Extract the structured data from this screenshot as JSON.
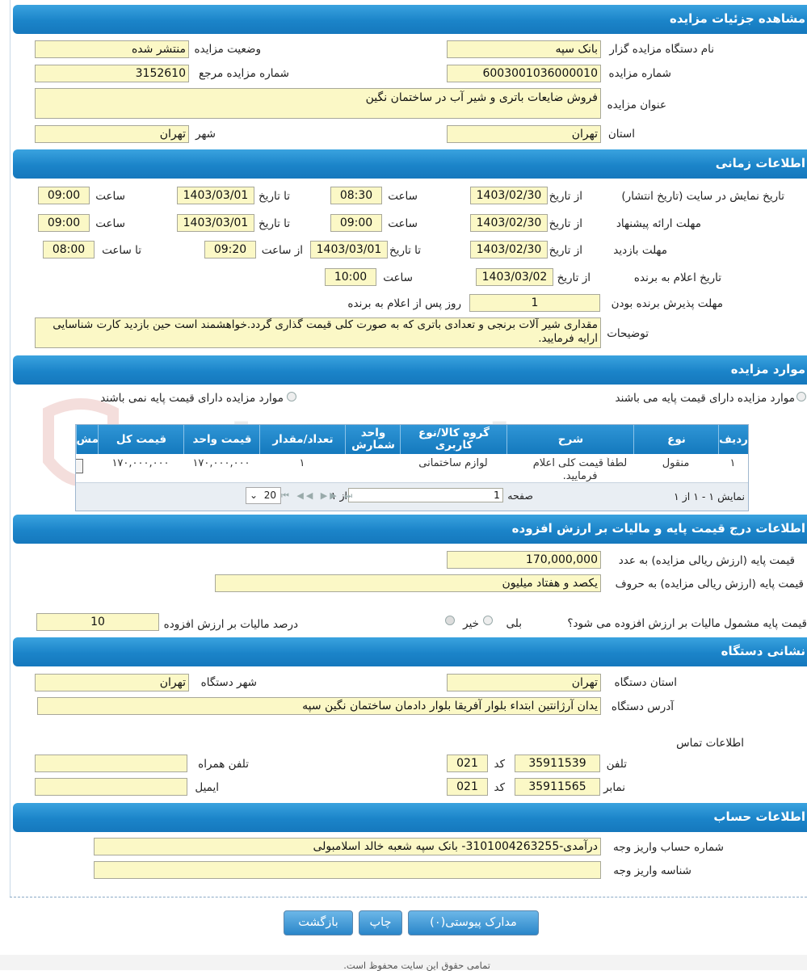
{
  "sections": {
    "details": "مشاهده جزئیات مزایده",
    "time": "اطلاعات زمانی",
    "items": "موارد مزایده",
    "price": "اطلاعات درج قیمت پایه و مالیات بر ارزش افزوده",
    "address": "نشانی دستگاه",
    "account": "اطلاعات حساب"
  },
  "details": {
    "org_label": "نام دستگاه مزایده گزار",
    "org_value": "بانک سپه",
    "status_label": "وضعیت مزایده",
    "status_value": "منتشر شده",
    "number_label": "شماره مزایده",
    "number_value": "6003001036000010",
    "ref_label": "شماره مزایده مرجع",
    "ref_value": "3152610",
    "title_label": "عنوان مزایده",
    "title_value": "فروش ضایعات باتری و شیر آب در ساختمان نگین",
    "province_label": "استان",
    "province_value": "تهران",
    "city_label": "شهر",
    "city_value": "تهران"
  },
  "time": {
    "display_label": "تاریخ نمایش در سایت (تاریخ انتشار)",
    "offer_label": "مهلت ارائه پیشنهاد",
    "visit_label": "مهلت بازدید",
    "announce_label": "تاریخ اعلام به برنده",
    "accept_label": "مهلت پذیرش برنده بودن",
    "from_date": "از تاریخ",
    "to_date": "تا تاریخ",
    "hour": "ساعت",
    "from_hour": "از ساعت",
    "to_hour": "تا ساعت",
    "display_from": "1403/02/30",
    "display_from_time": "08:30",
    "display_to": "1403/03/01",
    "display_to_time": "09:00",
    "offer_from": "1403/02/30",
    "offer_from_time": "09:00",
    "offer_to": "1403/03/01",
    "offer_to_time": "09:00",
    "visit_from": "1403/02/30",
    "visit_to": "1403/03/01",
    "visit_from_time": "09:20",
    "visit_to_time": "08:00",
    "announce_date": "1403/03/02",
    "announce_time": "10:00",
    "accept_days": "1",
    "accept_suffix": "روز پس از اعلام به برنده",
    "desc_label": "توضیحات",
    "desc_value": "مقداری شیر آلات برنجی و تعدادی باتری که به صورت کلی قیمت گذاری گردد.خواهشمند است حین بازدید کارت شناسایی ارایه فرمایید."
  },
  "items": {
    "radio_with_base": "موارد مزایده دارای قیمت پایه می باشند",
    "radio_without_base": "موارد مزایده دارای قیمت پایه نمی باشند",
    "columns": [
      "ردیف",
      "نوع",
      "شرح",
      "گروه کالا/نوع کاربری",
      "واحد شمارش",
      "تعداد/مقدار",
      "قیمت واحد",
      "قیمت کل",
      "مش"
    ],
    "row": [
      "۱",
      "منقول",
      "لطفاً قیمت کلی اعلام فرمایید.",
      "لوازم ساختمانی",
      "",
      "۱",
      "۱۷۰,۰۰۰,۰۰۰",
      "۱۷۰,۰۰۰,۰۰۰"
    ],
    "summary": "نمایش ۱ - ۱ از ۱",
    "page_label": "صفحه",
    "page_value": "1",
    "of_label": "از ۱",
    "page_size": "20"
  },
  "price": {
    "base_num_label": "قیمت پایه (ارزش ریالی مزایده) به عدد",
    "base_num_value": "170,000,000",
    "base_words_label": "قیمت پایه (ارزش ریالی مزایده) به حروف",
    "base_words_value": "یکصد و هفتاد میلیون",
    "vat_question": "قیمت پایه مشمول مالیات بر ارزش افزوده می شود؟",
    "yes": "بلی",
    "no": "خیر",
    "vat_percent_label": "درصد مالیات بر ارزش افزوده",
    "vat_percent_value": "10"
  },
  "address": {
    "province_label": "استان دستگاه",
    "province_value": "تهران",
    "city_label": "شهر دستگاه",
    "city_value": "تهران",
    "address_label": "آدرس دستگاه",
    "address_value": "یدان آرژانتین ابتداء بلوار آفریقا بلوار دادمان ساختمان نگین سپه",
    "contact_label": "اطلاعات تماس",
    "phone_label": "تلفن",
    "phone_value": "35911539",
    "phone_code": "021",
    "code_label": "کد",
    "mobile_label": "تلفن همراه",
    "mobile_value": "",
    "fax_label": "نمابر",
    "fax_value": "35911565",
    "fax_code": "021",
    "email_label": "ایمیل",
    "email_value": ""
  },
  "account": {
    "number_label": "شماره حساب واریز وجه",
    "number_value": "درآمدی-3101004263255- بانک سپه شعبه خالد اسلامبولی",
    "id_label": "شناسه واریز وجه",
    "id_value": ""
  },
  "buttons": {
    "attachments": "مدارک پیوستی(۰)",
    "print": "چاپ",
    "back": "بازگشت"
  },
  "footer": "تمامی حقوق این سایت محفوظ است."
}
